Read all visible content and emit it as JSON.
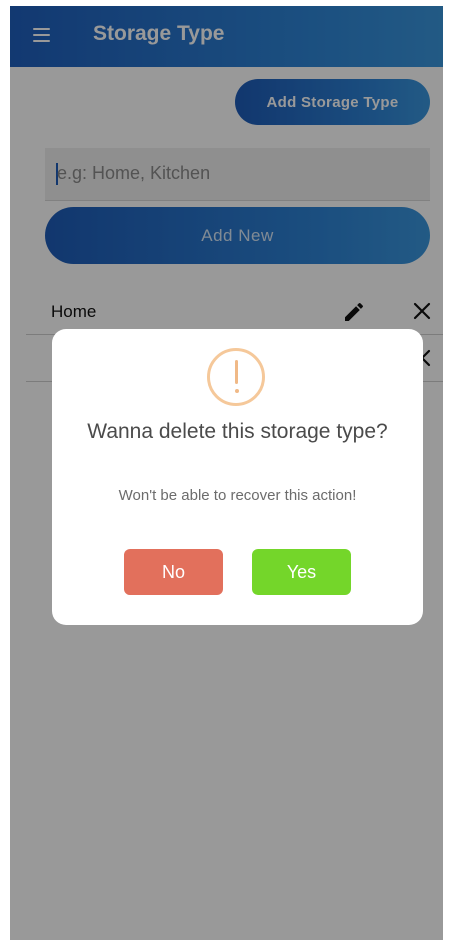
{
  "header": {
    "title": "Storage Type",
    "menu_icon": "hamburger-menu-icon"
  },
  "toolbar": {
    "add_storage_type_label": "Add Storage Type"
  },
  "form": {
    "placeholder": "e.g: Home, Kitchen",
    "add_new_label": "Add New"
  },
  "list": {
    "items": [
      {
        "label": "Home",
        "edit_icon": "pencil-icon",
        "delete_icon": "close-icon"
      },
      {
        "label": "",
        "edit_icon": "pencil-icon",
        "delete_icon": "close-icon"
      }
    ]
  },
  "dialog": {
    "icon": "warning-icon",
    "icon_color": "#f5c89a",
    "title": "Wanna delete this storage type?",
    "message": "Won't be able to recover this action!",
    "no_label": "No",
    "yes_label": "Yes",
    "no_color": "#e2705c",
    "yes_color": "#74d62a"
  },
  "colors": {
    "primary": "#1f5fbd",
    "primary_light": "#3a96dd"
  }
}
